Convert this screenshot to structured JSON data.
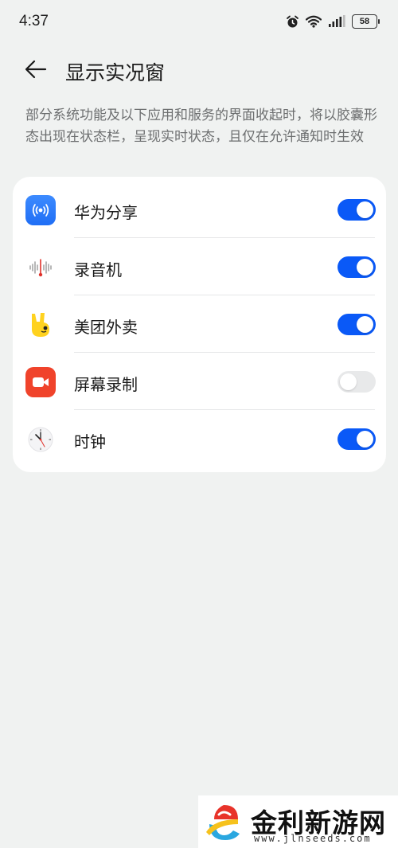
{
  "status_bar": {
    "time": "4:37",
    "battery": "58"
  },
  "header": {
    "title": "显示实况窗"
  },
  "description": "部分系统功能及以下应用和服务的界面收起时，将以胶囊形态出现在状态栏，呈现实时状态，且仅在允许通知时生效",
  "apps": [
    {
      "label": "华为分享",
      "icon": "huawei-share-icon",
      "enabled": true
    },
    {
      "label": "录音机",
      "icon": "recorder-icon",
      "enabled": true
    },
    {
      "label": "美团外卖",
      "icon": "meituan-waimai-icon",
      "enabled": true
    },
    {
      "label": "屏幕录制",
      "icon": "screen-recorder-icon",
      "enabled": false
    },
    {
      "label": "时钟",
      "icon": "clock-icon",
      "enabled": true
    }
  ],
  "watermark": {
    "title": "金利新游网",
    "url": "www.jlnseeds.com"
  },
  "colors": {
    "accent": "#0a59f7",
    "background": "#f0f2f1",
    "card": "#ffffff"
  }
}
